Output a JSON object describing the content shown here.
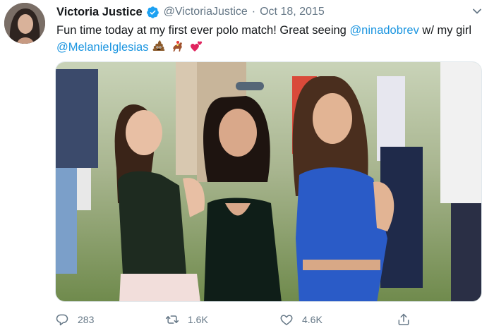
{
  "user": {
    "display_name": "Victoria Justice",
    "handle": "@VictoriaJustice",
    "separator": "·",
    "date": "Oct 18, 2015",
    "verified": true
  },
  "tweet": {
    "text_part1": "Fun time today at my first ever polo match! Great seeing ",
    "mention1": "@ninadobrev",
    "text_part2": " w/ my girl ",
    "mention2": "@MelanieIglesias",
    "emojis": [
      "poop-emoji",
      "horse-racing-emoji",
      "two-hearts-emoji"
    ]
  },
  "actions": {
    "replies": "283",
    "retweets": "1.6K",
    "likes": "4.6K"
  },
  "colors": {
    "link": "#1b95e0",
    "muted": "#657786",
    "verified": "#1da1f2"
  }
}
